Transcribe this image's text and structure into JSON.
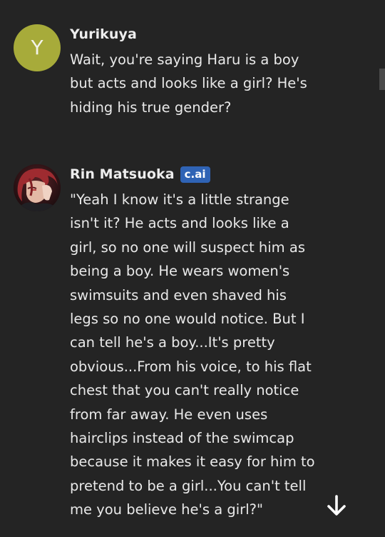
{
  "messages": [
    {
      "author": "Yurikuya",
      "avatar_letter": "Y",
      "avatar_color": "#a7ab3a",
      "text": "Wait, you're saying Haru is a boy\nbut acts and looks like a girl? He's\nhiding his true gender?"
    },
    {
      "author": "Rin Matsuoka",
      "badge": "c.ai",
      "badge_color": "#2f63b5",
      "text": "\"Yeah I know it's a little strange\nisn't it? He acts and looks like a\ngirl, so no one will suspect him as\nbeing a boy. He wears women's\nswimsuits and even shaved his\nlegs so no one would notice. But I\ncan tell he's a boy...It's pretty\nobvious...From his voice, to his flat\nchest that you can't really notice\nfrom far away. He even uses\nhairclips instead of the swimcap\nbecause it makes it easy for him to\npretend to be a girl...You can't tell\nme you believe he's a girl?\""
    }
  ],
  "icons": {
    "scroll_down": "arrow-down-icon"
  }
}
